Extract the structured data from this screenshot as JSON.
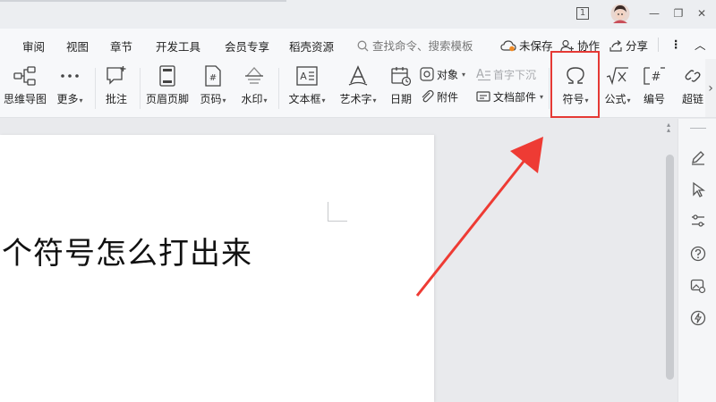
{
  "window": {
    "controls": [
      "1",
      "—",
      "❐",
      "✕"
    ]
  },
  "menu_bar": {
    "tabs": [
      "审阅",
      "视图",
      "章节",
      "开发工具",
      "会员专享",
      "稻壳资源"
    ],
    "search_placeholder": "查找命令、搜索模板",
    "status": "未保存",
    "collaborate": "协作",
    "share": "分享",
    "more": "⋮",
    "collapse": "︿"
  },
  "ribbon": {
    "mindmap": "思维导图",
    "more": "更多",
    "comment": "批注",
    "header_footer": "页眉页脚",
    "page_number": "页码",
    "watermark": "水印",
    "textbox": "文本框",
    "wordart": "艺术字",
    "date": "日期",
    "object": "对象",
    "attachment": "附件",
    "dropcap": "首字下沉",
    "doc_parts": "文档部件",
    "symbol": "符号",
    "formula": "公式",
    "numbering": "编号",
    "hyperlink": "超链",
    "scroll_right": "›"
  },
  "document": {
    "text": "个符号怎么打出来"
  },
  "colors": {
    "highlight": "#e53935",
    "arrow": "#ee3b34"
  }
}
